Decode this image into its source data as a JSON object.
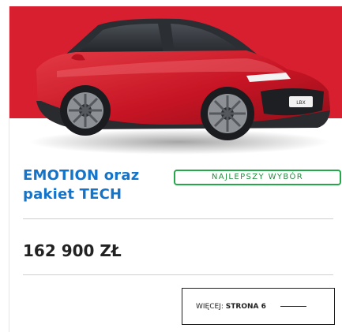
{
  "card": {
    "image": {
      "subject": "red-lexus-lbx-suv",
      "plate_text": "LBX",
      "band_color": "#d71f2f",
      "car_color": "#c71424"
    },
    "title": "EMOTION oraz pakiet TECH",
    "badge": "NAJLEPSZY WYBÓR",
    "price": "162 900 ZŁ",
    "more_button": {
      "prefix": "WIĘCEJ: ",
      "emphasis": "STRONA 6"
    },
    "colors": {
      "title": "#1474c9",
      "badge": "#23a84a"
    }
  }
}
